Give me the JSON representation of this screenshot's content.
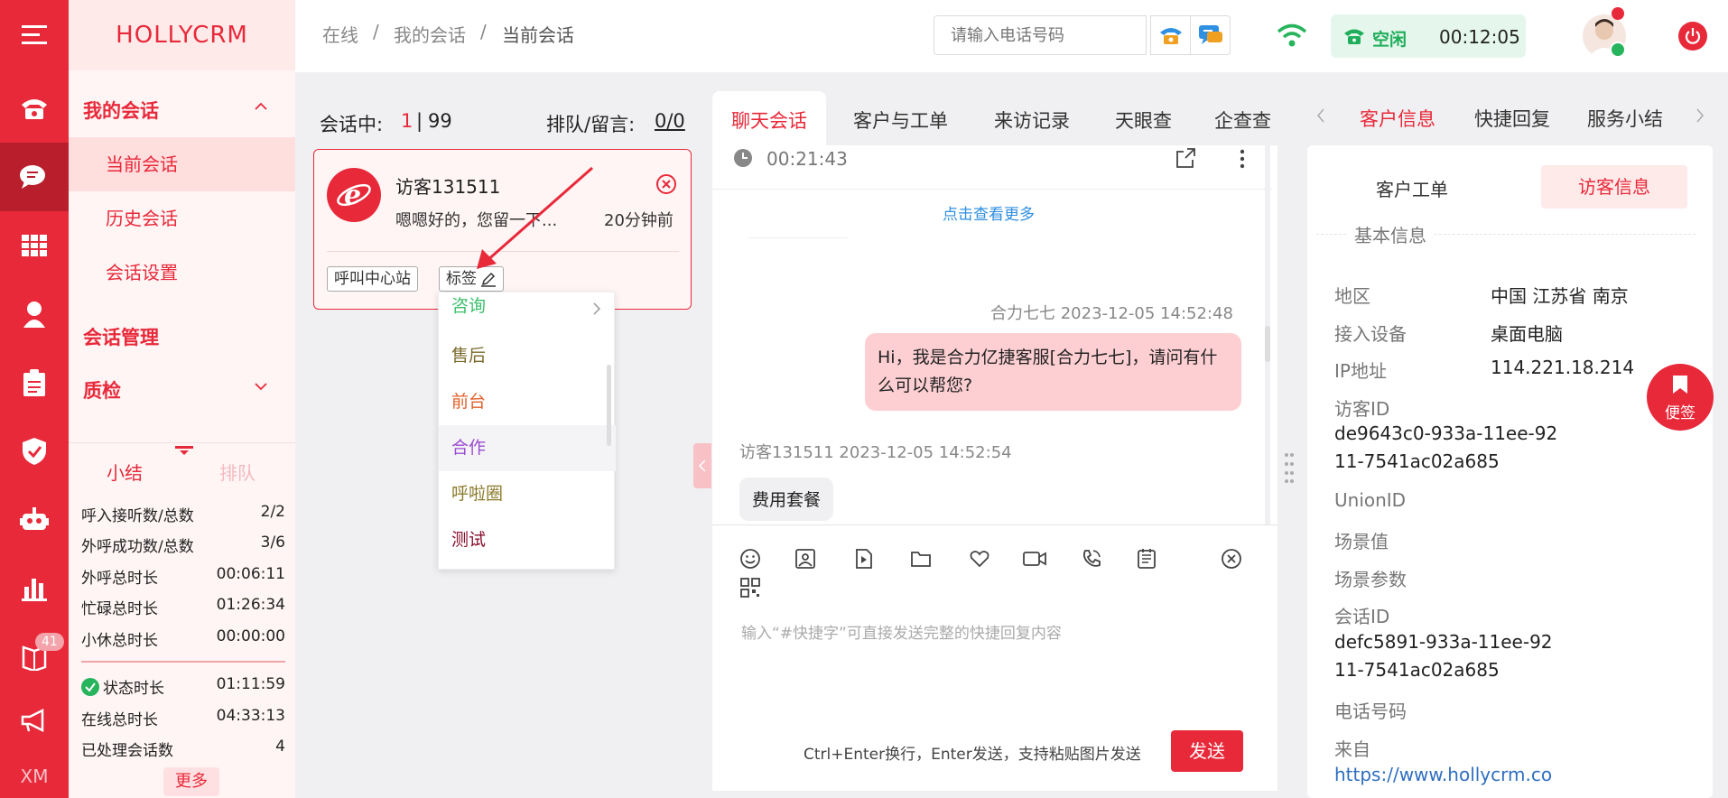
{
  "brand": "HOLLYCRM",
  "rail": {
    "badge": "41",
    "footer": "XM"
  },
  "breadcrumb": [
    "在线",
    "我的会话",
    "当前会话"
  ],
  "header": {
    "phone_placeholder": "请输入电话号码",
    "status_label": "空闲",
    "status_time": "00:12:05"
  },
  "side_menu": {
    "group1": "我的会话",
    "items": [
      "当前会话",
      "历史会话",
      "会话设置"
    ],
    "group2": "会话管理",
    "group3": "质检"
  },
  "summary": {
    "tabs": [
      "小结",
      "排队"
    ],
    "stats": [
      {
        "label": "呼入接听数/总数",
        "value": "2/2"
      },
      {
        "label": "外呼成功数/总数",
        "value": "3/6"
      },
      {
        "label": "外呼总时长",
        "value": "00:06:11"
      },
      {
        "label": "忙碌总时长",
        "value": "01:26:34"
      },
      {
        "label": "小休总时长",
        "value": "00:00:00"
      }
    ],
    "stats2": [
      {
        "label": "状态时长",
        "value": "01:11:59"
      },
      {
        "label": "在线总时长",
        "value": "04:33:13"
      },
      {
        "label": "已处理会话数",
        "value": "4"
      }
    ],
    "more": "更多"
  },
  "session_list": {
    "in_session_label": "会话中:",
    "active": "1",
    "sep": "|",
    "total": "99",
    "queue_label": "排队/留言:",
    "queue_value": "0/0",
    "card": {
      "name": "访客131511",
      "preview": "嗯嗯好的，您留一下...",
      "time": "20分钟前",
      "source_tag": "呼叫中心站",
      "tag_button": "标签"
    }
  },
  "tag_menu": [
    {
      "label": "咨询",
      "color": "#3bbf6a"
    },
    {
      "label": "售后",
      "color": "#7a6a2a"
    },
    {
      "label": "前台",
      "color": "#e0602a"
    },
    {
      "label": "合作",
      "color": "#9a4ccf"
    },
    {
      "label": "呼啦圈",
      "color": "#8a7a2a"
    },
    {
      "label": "测试",
      "color": "#8a1030"
    }
  ],
  "chat": {
    "tabs": [
      "聊天会话",
      "客户与工单",
      "来访记录",
      "天眼查",
      "企查查"
    ],
    "timer": "00:21:43",
    "load_more": "点击查看更多",
    "messages": [
      {
        "meta": "合力七七 2023-12-05 14:52:48",
        "text": "Hi，我是合力亿捷客服[合力七七]，请问有什么可以帮您?"
      },
      {
        "meta": "访客131511 2023-12-05 14:52:54",
        "text": "费用套餐"
      }
    ],
    "input_placeholder": "输入“#快捷字”可直接发送完整的快捷回复内容",
    "hint": "Ctrl+Enter换行，Enter发送，支持粘贴图片发送",
    "send": "发送"
  },
  "right_panel": {
    "tabs": [
      "客户信息",
      "快捷回复",
      "服务小结"
    ],
    "sub_tabs": [
      "客户工单",
      "访客信息"
    ],
    "section": "基本信息",
    "floating": "便签",
    "fields": {
      "region_label": "地区",
      "region": "中国 江苏省 南京",
      "device_label": "接入设备",
      "device": "桌面电脑",
      "ip_label": "IP地址",
      "ip": "114.221.18.214",
      "visitor_id_label": "访客ID",
      "visitor_id_1": "de9643c0-933a-11ee-92",
      "visitor_id_2": "11-7541ac02a685",
      "union_label": "UnionID",
      "scene_label": "场景值",
      "scene_param_label": "场景参数",
      "session_id_label": "会话ID",
      "session_id_1": "defc5891-933a-11ee-92",
      "session_id_2": "11-7541ac02a685",
      "phone_label": "电话号码",
      "from_label": "来自",
      "from": "https://www.hollycrm.co"
    }
  },
  "colors": {
    "primary": "#e8293a",
    "status_green": "#1fae5b"
  }
}
